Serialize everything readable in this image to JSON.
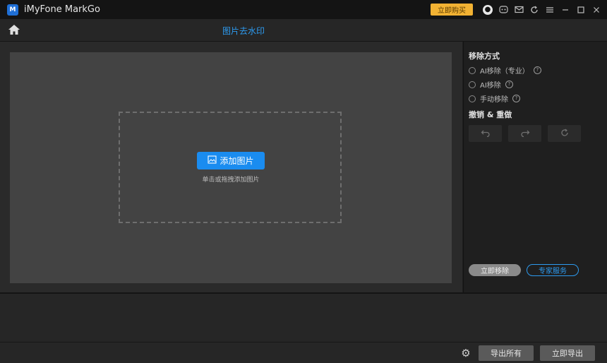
{
  "window": {
    "app_title": "iMyFone MarkGo",
    "upgrade_label": "立即购买",
    "icons": [
      "user-icon",
      "discord-icon",
      "mail-icon",
      "refresh-icon",
      "menu-icon",
      "minimize-icon",
      "maximize-icon",
      "close-icon"
    ]
  },
  "topbar": {
    "page_title": "图片去水印"
  },
  "canvas": {
    "add_button_label": "添加图片",
    "hint": "单击或拖拽添加图片"
  },
  "right_panel": {
    "removal_title": "移除方式",
    "options": [
      {
        "label": "AI移除（专业）",
        "help": "?"
      },
      {
        "label": "AI移除",
        "help": "?"
      },
      {
        "label": "手动移除",
        "help": "?"
      }
    ],
    "undo_title": "撤销 & 重做",
    "remove_now_label": "立即移除",
    "feedback_label": "专家服务"
  },
  "footer": {
    "export_all_label": "导出所有",
    "export_now_label": "立即导出"
  },
  "colors": {
    "accent": "#1a8cf0",
    "upgrade": "#f2b233"
  }
}
